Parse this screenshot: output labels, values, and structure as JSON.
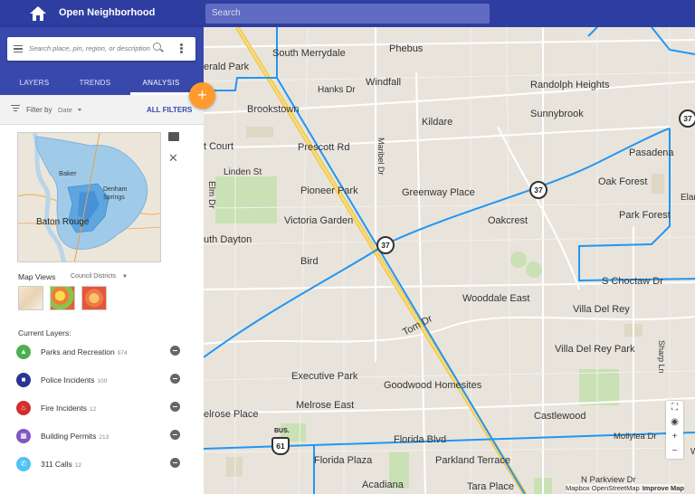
{
  "app": {
    "title": "Open Neighborhood",
    "search_placeholder": "Search"
  },
  "panel": {
    "search_placeholder": "Search place, pin, region, or description",
    "tabs": [
      {
        "label": "LAYERS"
      },
      {
        "label": "TRENDS"
      },
      {
        "label": "ANALYSIS",
        "active": true
      }
    ],
    "filter": {
      "label": "Filter by",
      "value": "Date",
      "all_filters": "ALL FILTERS"
    },
    "minimap": {
      "labels": [
        "Baker",
        "Denham Springs",
        "Baton Rouge"
      ]
    },
    "map_views": {
      "label": "Map Views",
      "value": "Council Districts"
    },
    "current_layers_label": "Current Layers:",
    "layers": [
      {
        "name": "Parks and Recreation",
        "count": "974",
        "color": "#4caf50",
        "icon": "park-icon"
      },
      {
        "name": "Police Incidents",
        "count": "100",
        "color": "#283593",
        "icon": "police-car-icon"
      },
      {
        "name": "Fire Incidents",
        "count": "12",
        "color": "#d32f2f",
        "icon": "fire-icon"
      },
      {
        "name": "Building Permits",
        "count": "213",
        "color": "#7e57c2",
        "icon": "building-icon"
      },
      {
        "name": "311 Calls",
        "count": "12",
        "color": "#4fc3f7",
        "icon": "phone-icon"
      }
    ]
  },
  "map": {
    "labels": [
      "South Merrydale",
      "Phebus",
      "erald Park",
      "Hanks Dr",
      "Windfall",
      "Randolph Heights",
      "Brookstown",
      "Kildare",
      "Sunnybrook",
      "t Court",
      "Prescott Rd",
      "Pasadena",
      "Linden St",
      "Maribel Dr",
      "Pioneer Park",
      "Greenway Place",
      "Oak Forest",
      "Elm Dr",
      "Victoria Garden",
      "Oakcrest",
      "Park Forest",
      "uth Dayton",
      "Bird",
      "S Choctaw Dr",
      "Wooddale East",
      "Villa Del Rey",
      "Tom Dr",
      "Villa Del Rey Park",
      "Sharp Ln",
      "Executive Park",
      "Goodwood Homesites",
      "Melrose East",
      "Castlewood",
      "elrose Place",
      "Mollylea Dr",
      "Florida Blvd",
      "Florida Plaza",
      "Parkland Terrace",
      "Acadiana",
      "Tara Place",
      "N Parkview Dr",
      "Elar",
      "W"
    ],
    "shields": [
      "37",
      "37",
      "37",
      "61"
    ],
    "bus_label": "BUS.",
    "attribution": "Mapbox OpenStreetMap",
    "improve": "Improve Map"
  },
  "colors": {
    "header": "#2e3da0",
    "accent": "#ff9b2e",
    "route": "#2196f3",
    "highway": "#f2c94c"
  }
}
